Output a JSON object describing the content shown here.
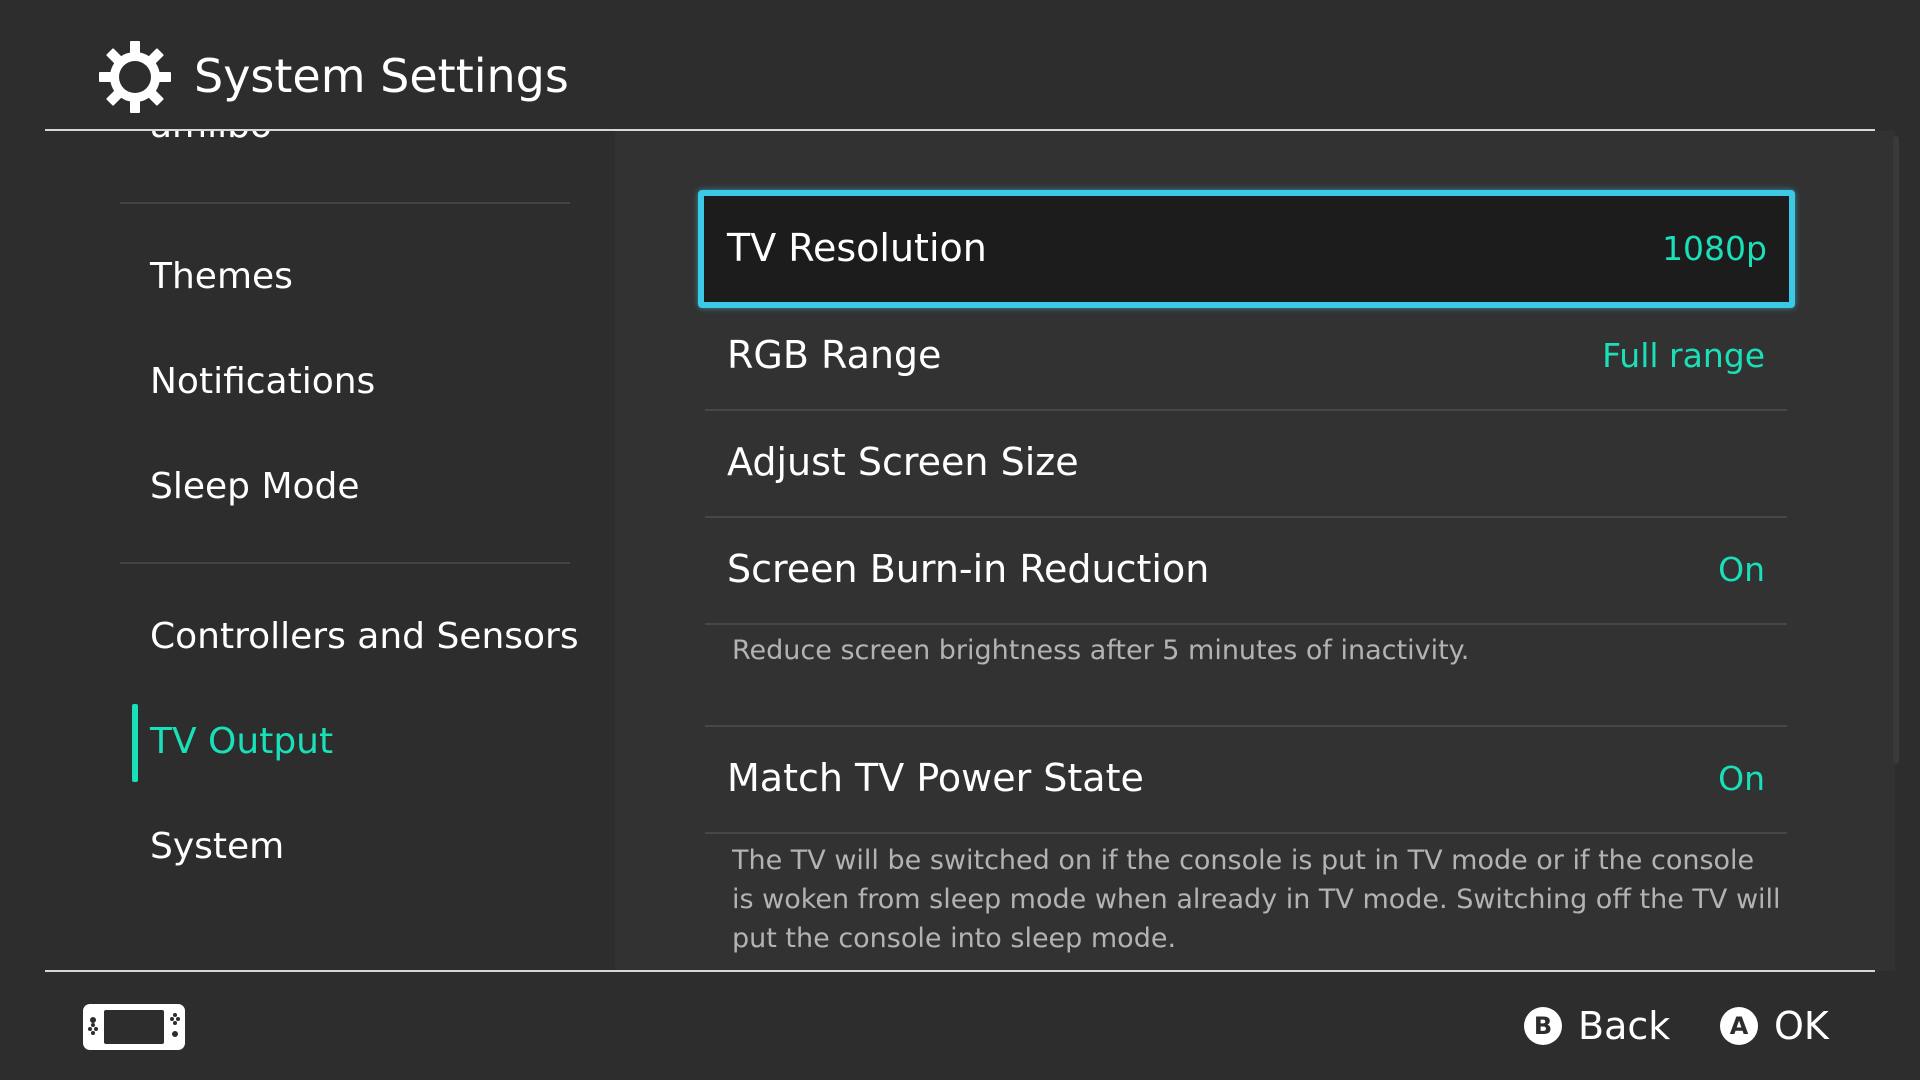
{
  "header": {
    "title": "System Settings",
    "icon": "gear-icon"
  },
  "sidebar": {
    "partial_item": "amiibo",
    "items": [
      {
        "label": "Themes"
      },
      {
        "label": "Notifications"
      },
      {
        "label": "Sleep Mode"
      },
      {
        "label": "Controllers and Sensors"
      },
      {
        "label": "TV Output"
      },
      {
        "label": "System"
      }
    ],
    "selected": "TV Output"
  },
  "settings": {
    "tv_resolution": {
      "label": "TV Resolution",
      "value": "1080p"
    },
    "rgb_range": {
      "label": "RGB Range",
      "value": "Full range"
    },
    "adjust_screen_size": {
      "label": "Adjust Screen Size"
    },
    "burn_in": {
      "label": "Screen Burn-in Reduction",
      "value": "On",
      "description": "Reduce screen brightness after 5 minutes of inactivity."
    },
    "match_power": {
      "label": "Match TV Power State",
      "value": "On",
      "description": "The TV will be switched on if the console is put in TV mode or if the console is woken from sleep mode when already in TV mode. Switching off the TV will put the console into sleep mode."
    }
  },
  "footer": {
    "console_icon": "console-icon",
    "back": {
      "button": "B",
      "label": "Back"
    },
    "ok": {
      "button": "A",
      "label": "OK"
    }
  },
  "colors": {
    "background": "#2d2d2d",
    "panel": "#323232",
    "accent": "#19e0b9",
    "focus_border": "#3cc9e6"
  }
}
